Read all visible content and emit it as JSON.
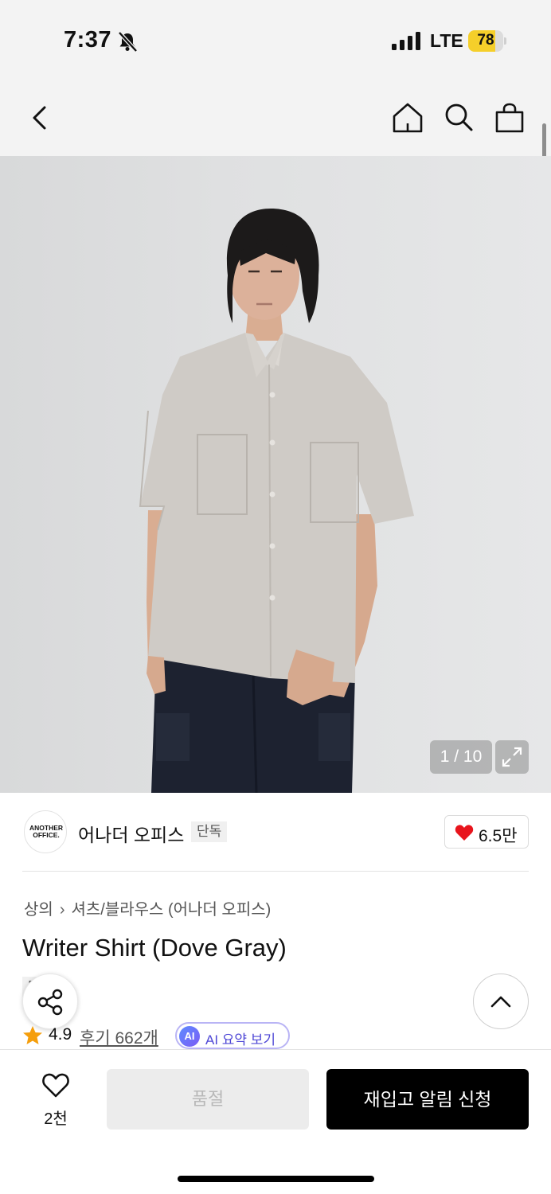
{
  "status_bar": {
    "time": "7:37",
    "network": "LTE",
    "battery_level": "78",
    "battery_fraction": 0.78,
    "battery_color": "#f5cf2a"
  },
  "nav": {
    "icons": [
      "back-icon",
      "home-icon",
      "search-icon",
      "cart-icon"
    ]
  },
  "gallery": {
    "counter": "1 / 10"
  },
  "brand": {
    "logo_line1": "ANOTHER",
    "logo_line2": "OFFICE.",
    "name": "어나더 오피스",
    "exclusive_badge": "단독",
    "like_count": "6.5만",
    "heart_color": "#e8141c"
  },
  "product": {
    "breadcrumb_category": "상의",
    "breadcrumb_subcategory": "셔츠/블라우스 (어나더 오피스)",
    "title": "Writer Shirt (Dove Gray)",
    "tag_badge": "단독",
    "rating": "4.9",
    "reviews_link": "후기 662개",
    "ai_badge": "AI",
    "ai_summary_label": "AI 요약 보기"
  },
  "bottom_bar": {
    "wish_count": "2천",
    "soldout_label": "품절",
    "restock_label": "재입고 알림 신청"
  }
}
